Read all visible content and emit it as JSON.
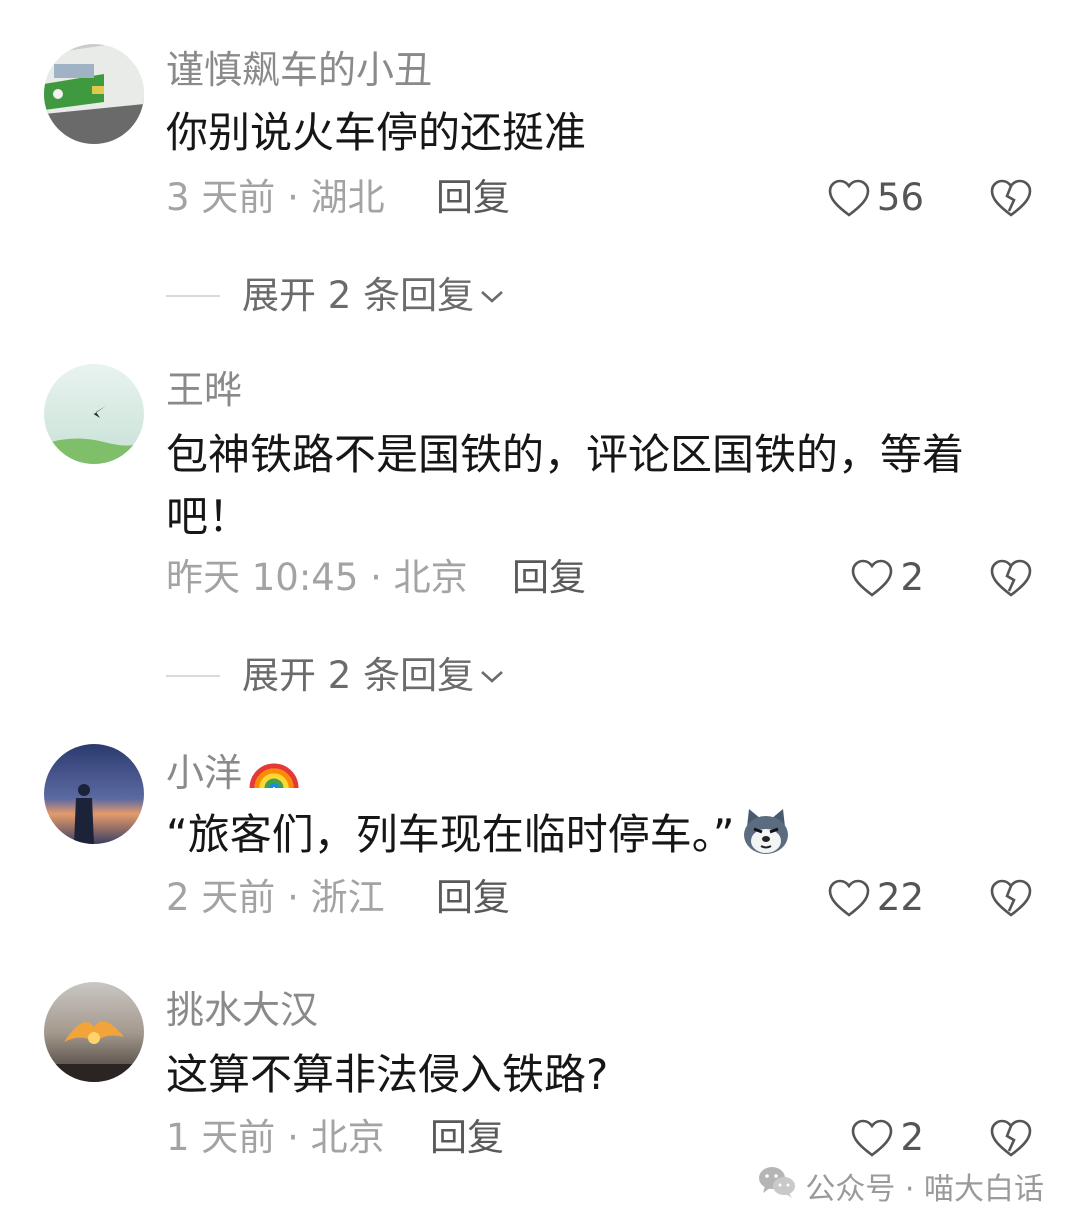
{
  "comments": [
    {
      "username": "谨慎飙车的小丑",
      "text": "你别说火车停的还挺准",
      "time_location": "3 天前 · 湖北",
      "reply_label": "回复",
      "likes": "56",
      "expand_label": "展开 2 条回复",
      "avatar": "train-front-avatar"
    },
    {
      "username": "王晔",
      "text": "包神铁路不是国铁的，评论区国铁的，等着吧！",
      "time_location": "昨天 10:45 · 北京",
      "reply_label": "回复",
      "likes": "2",
      "expand_label": "展开 2 条回复",
      "avatar": "swallow-sky-avatar"
    },
    {
      "username": "小洋",
      "username_emoji": "rainbow-icon",
      "text": "“旅客们，列车现在临时停车。”",
      "text_emoji": "husky-dog-emoji",
      "time_location": "2 天前 · 浙江",
      "reply_label": "回复",
      "likes": "22",
      "avatar": "sunset-person-avatar"
    },
    {
      "username": "挑水大汉",
      "text": "这算不算非法侵入铁路?",
      "time_location": "1 天前 · 北京",
      "reply_label": "回复",
      "likes": "2",
      "avatar": "sunset-clouds-avatar"
    }
  ],
  "watermark": {
    "icon": "wechat-icon",
    "text": "公众号 · 喵大白话"
  },
  "colors": {
    "text_primary": "#161616",
    "text_secondary": "#8a8a8a",
    "meta": "#a3a3a3",
    "divider": "#d9d9d9"
  }
}
